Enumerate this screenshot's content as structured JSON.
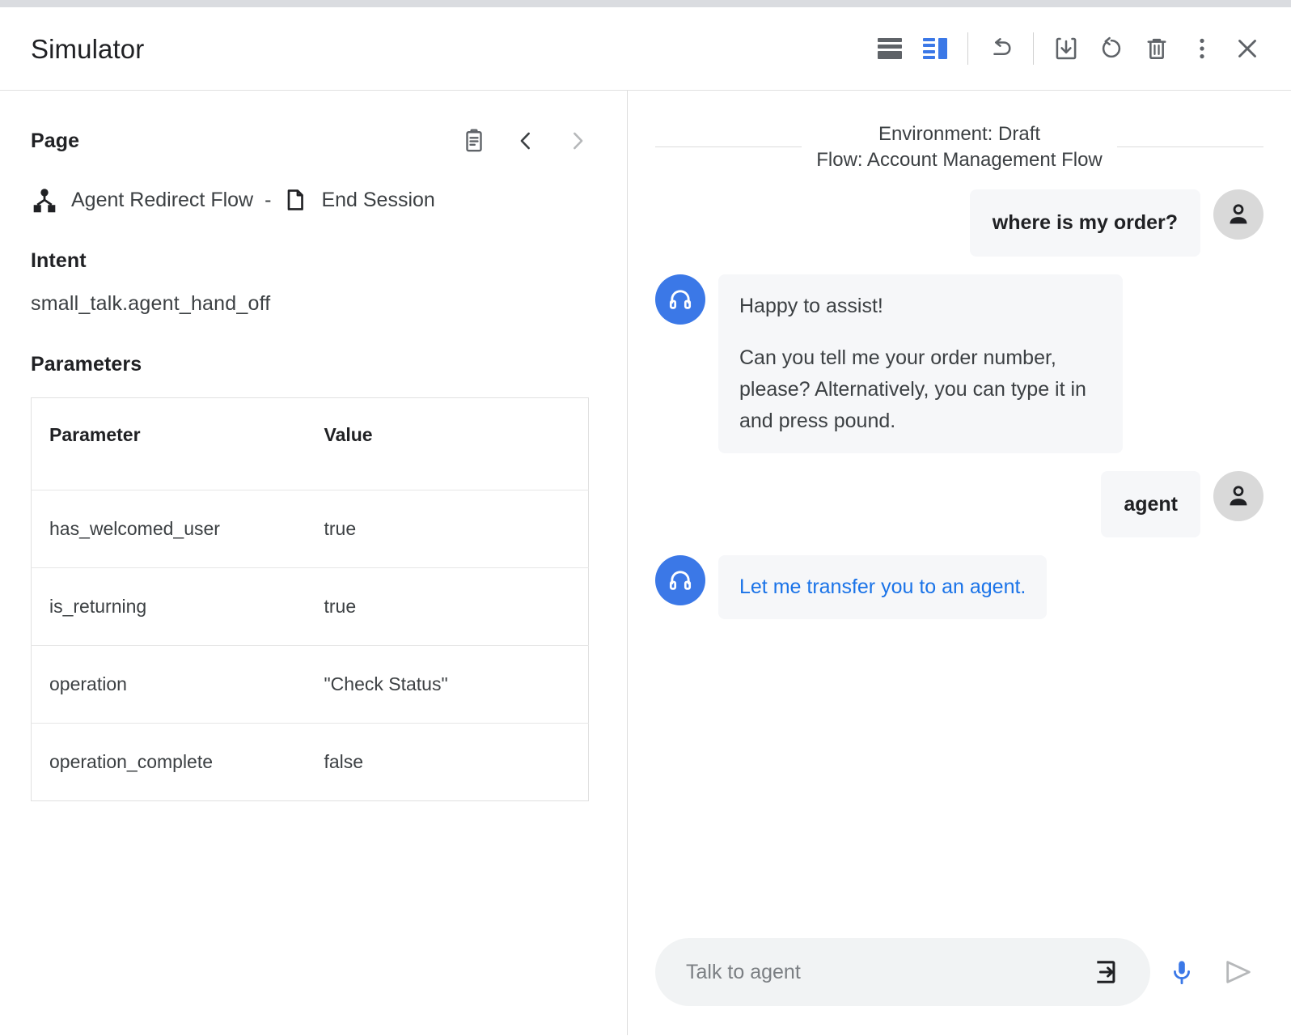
{
  "window": {
    "title": "Simulator"
  },
  "toolbar": {
    "items": [
      {
        "name": "layout-horizontal-split",
        "label": "Horizontal split layout",
        "active": false
      },
      {
        "name": "layout-vertical-split",
        "label": "Vertical split layout",
        "active": true
      },
      {
        "name": "undo",
        "label": "Undo"
      },
      {
        "name": "save",
        "label": "Save"
      },
      {
        "name": "restart",
        "label": "Restart session"
      },
      {
        "name": "delete",
        "label": "Delete"
      },
      {
        "name": "more-options",
        "label": "More options"
      },
      {
        "name": "close",
        "label": "Close"
      }
    ]
  },
  "left_panel": {
    "page_section_label": "Page",
    "page_actions": [
      {
        "name": "copy-to-clipboard",
        "label": "Copy"
      },
      {
        "name": "previous-page",
        "label": "Previous"
      },
      {
        "name": "next-page",
        "label": "Next"
      }
    ],
    "breadcrumb": {
      "flow_name": "Agent Redirect Flow",
      "separator": "-",
      "page_name": "End Session"
    },
    "intent_label": "Intent",
    "intent_value": "small_talk.agent_hand_off",
    "parameters_label": "Parameters",
    "parameters_table": {
      "columns": [
        "Parameter",
        "Value"
      ],
      "rows": [
        {
          "parameter": "has_welcomed_user",
          "value": "true"
        },
        {
          "parameter": "is_returning",
          "value": "true"
        },
        {
          "parameter": "operation",
          "value": "\"Check Status\""
        },
        {
          "parameter": "operation_complete",
          "value": "false"
        }
      ]
    }
  },
  "right_panel": {
    "environment_line": "Environment: Draft",
    "flow_line": "Flow: Account Management Flow",
    "messages": [
      {
        "role": "user",
        "text": "where is my order?"
      },
      {
        "role": "bot",
        "paragraphs": [
          "Happy to assist!",
          "Can you tell me your order number, please? Alternatively, you can type it in and press pound."
        ]
      },
      {
        "role": "user",
        "text": "agent"
      },
      {
        "role": "bot",
        "text": "Let me transfer you to an agent.",
        "link": true
      }
    ],
    "message_1_text": "where is my order?",
    "message_2_p1": "Happy to assist!",
    "message_2_p2": "Can you tell me your order number, please? Alternatively, you can type it in and press pound.",
    "message_3_text": "agent",
    "message_4_text": "Let me transfer you to an agent.",
    "input": {
      "value": "",
      "placeholder": "Talk to agent"
    },
    "input_actions": [
      {
        "name": "send-event",
        "label": "Send event"
      },
      {
        "name": "microphone",
        "label": "Use microphone"
      },
      {
        "name": "send-message",
        "label": "Send"
      }
    ]
  },
  "colors": {
    "accent_blue": "#3b78e7",
    "link_blue": "#1a73e8",
    "icon_grey": "#5f6368",
    "bubble_bg": "#f6f7f9",
    "avatar_user_bg": "#d9d9d9",
    "input_bg": "#f1f3f4"
  }
}
